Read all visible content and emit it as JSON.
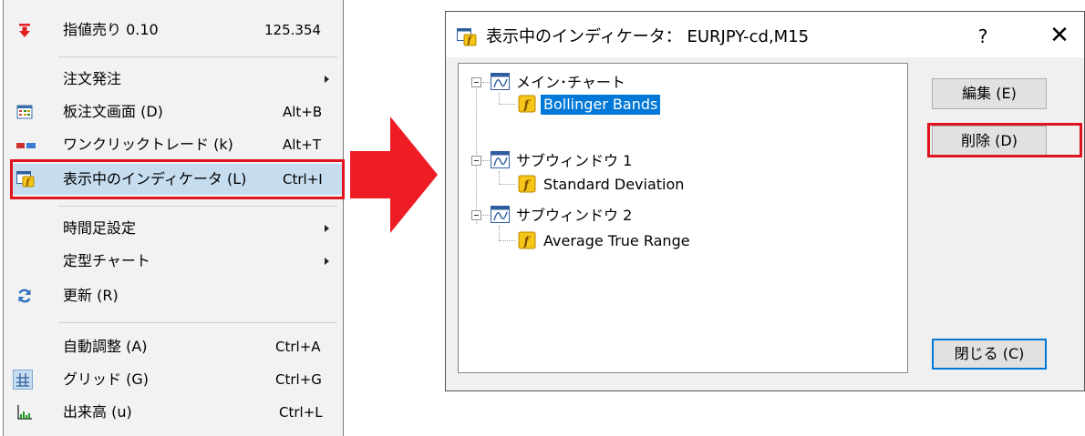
{
  "menu": {
    "items": [
      {
        "label": "指値売り 0.10",
        "shortcut": "125.354",
        "icon": "down-arrow-icon"
      },
      {
        "label": "注文発注",
        "submenu": true
      },
      {
        "label": "板注文画面 (D)",
        "shortcut": "Alt+B",
        "icon": "grid-table-icon"
      },
      {
        "label": "ワンクリックトレード (k)",
        "shortcut": "Alt+T",
        "icon": "one-click-trade-icon"
      },
      {
        "label": "表示中のインディケータ (L)",
        "shortcut": "Ctrl+I",
        "icon": "indicator-icon",
        "highlighted": true
      },
      {
        "label": "時間足設定",
        "submenu": true
      },
      {
        "label": "定型チャート",
        "submenu": true
      },
      {
        "label": "更新 (R)",
        "icon": "refresh-icon"
      },
      {
        "label": "自動調整 (A)",
        "shortcut": "Ctrl+A"
      },
      {
        "label": "グリッド (G)",
        "shortcut": "Ctrl+G",
        "icon": "grid-icon"
      },
      {
        "label": "出来高 (u)",
        "shortcut": "Ctrl+L",
        "icon": "volume-icon"
      }
    ]
  },
  "dialog": {
    "title": "表示中のインディケータ： EURJPY-cd,M15",
    "help": "?",
    "close": "✕",
    "tree": [
      {
        "label": "メイン･チャート",
        "children": [
          {
            "label": "Bollinger Bands",
            "selected": true
          }
        ]
      },
      {
        "label": "サブウィンドウ 1",
        "children": [
          {
            "label": "Standard Deviation"
          }
        ]
      },
      {
        "label": "サブウィンドウ 2",
        "children": [
          {
            "label": "Average True Range"
          }
        ]
      }
    ],
    "buttons": {
      "edit": "編集 (E)",
      "delete": "削除 (D)",
      "close": "閉じる (C)"
    }
  },
  "colors": {
    "highlight_red": "#e0141e",
    "selection_blue": "#0078d7",
    "menu_active": "#c6dcef"
  }
}
